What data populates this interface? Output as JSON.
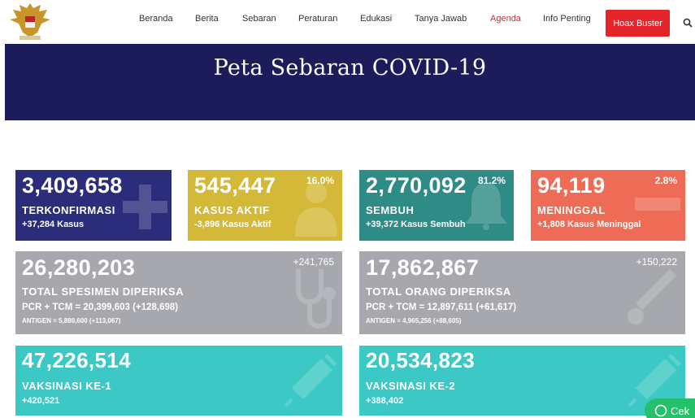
{
  "nav": {
    "items": [
      {
        "label": "Beranda"
      },
      {
        "label": "Berita"
      },
      {
        "label": "Sebaran"
      },
      {
        "label": "Peraturan"
      },
      {
        "label": "Edukasi"
      },
      {
        "label": "Tanya Jawab"
      },
      {
        "label": "Agenda"
      },
      {
        "label": "Info Penting"
      }
    ],
    "hoax_label": "Hoax Buster",
    "search_icon": "search-icon"
  },
  "banner": {
    "title": "Peta Sebaran COVID-19"
  },
  "stats": {
    "terkonfirmasi": {
      "value": "3,409,658",
      "label": "TERKONFIRMASI",
      "sub": "+37,284 Kasus"
    },
    "aktif": {
      "value": "545,447",
      "pct": "16.0%",
      "label": "KASUS AKTIF",
      "sub": "-3,896 Kasus Aktif"
    },
    "sembuh": {
      "value": "2,770,092",
      "pct": "81.2%",
      "label": "SEMBUH",
      "sub": "+39,372 Kasus Sembuh"
    },
    "meninggal": {
      "value": "94,119",
      "pct": "2.8%",
      "label": "MENINGGAL",
      "sub": "+1,808 Kasus Meninggal"
    },
    "spesimen": {
      "value": "26,280,203",
      "delta": "+241,765",
      "label": "TOTAL SPESIMEN DIPERIKSA",
      "sub": "PCR + TCM = 20,399,603 (+128,698)",
      "tiny": "ANTIGEN = 5,880,600 (+113,067)"
    },
    "orang": {
      "value": "17,862,867",
      "delta": "+150,222",
      "label": "TOTAL ORANG DIPERIKSA",
      "sub": "PCR + TCM = 12,897,611 (+61,617)",
      "tiny": "ANTIGEN = 4,965,256 (+88,605)"
    },
    "vaksin1": {
      "value": "47,226,514",
      "label": "VAKSINASI KE-1",
      "sub": "+420,521"
    },
    "vaksin2": {
      "value": "20,534,823",
      "label": "VAKSINASI KE-2",
      "sub": "+388,402"
    }
  },
  "whatsapp": {
    "label": "Cek"
  },
  "colors": {
    "banner": "#1c1c5a",
    "terkonfirmasi": "#2b2d7a",
    "aktif": "#d4b838",
    "sembuh": "#2f8b85",
    "meninggal": "#ee6b55",
    "grey": "#a6a8ad",
    "vaksin": "#3cc8c4",
    "hoax": "#e5252a"
  }
}
